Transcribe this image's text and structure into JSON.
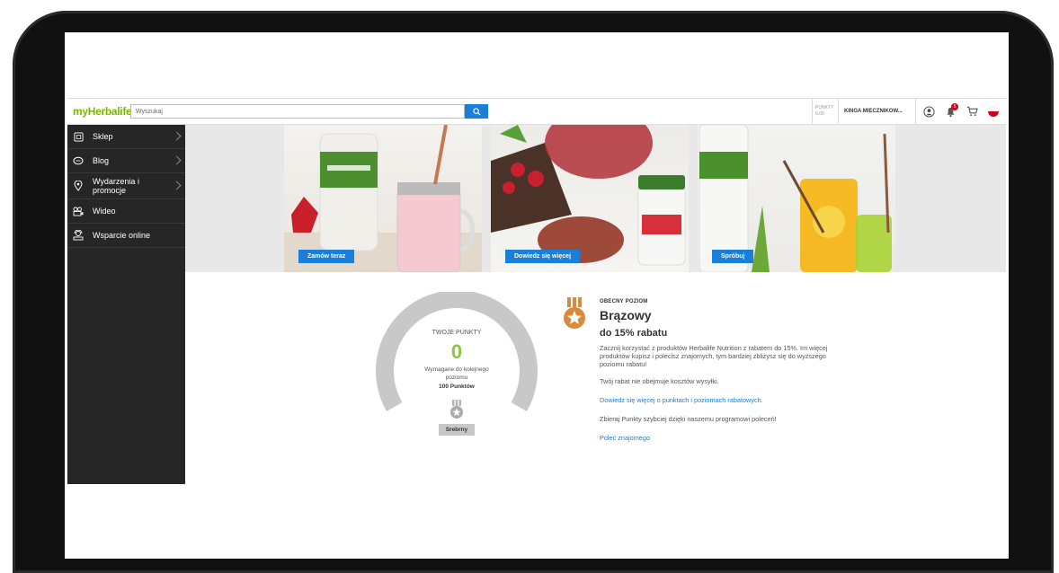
{
  "header": {
    "logo": "myHerbalife",
    "search_placeholder": "Wyszukaj",
    "points_label": "PUNKTY",
    "points_value": "0,00",
    "user_name": "KINGA MIECZNIKOW...",
    "notification_count": "5"
  },
  "sidebar": {
    "items": [
      {
        "label": "Sklep",
        "icon": "shop-icon"
      },
      {
        "label": "Blog",
        "icon": "chat-icon"
      },
      {
        "label": "Wydarzenia i promocje",
        "icon": "location-icon"
      },
      {
        "label": "Wideo",
        "icon": "video-icon"
      },
      {
        "label": "Wsparcie online",
        "icon": "support-icon"
      }
    ]
  },
  "banners": [
    {
      "cta": "Zamów teraz"
    },
    {
      "cta": "Dowiedz się więcej"
    },
    {
      "cta": "Spróbuj"
    }
  ],
  "gauge": {
    "title": "TWOJE PUNKTY",
    "value": "0",
    "required_line1": "Wymagane do kolejnego",
    "required_line2": "poziomu",
    "required_points": "100 Punktów",
    "next_level": "Srebrny",
    "progress": 0
  },
  "level": {
    "label": "OBECNY POZIOM",
    "name": "Brązowy",
    "discount": "do 15% rabatu",
    "description": "Zacznij korzystać z produktów Herbalife Nutrition z rabatem do 15%. Im więcej produktów kupisz i polecisz znajomych, tym bardziej zbliżysz się do wyższego poziomu rabatu!",
    "shipping_note": "Twój rabat nie obejmuje kosztów wysyłki.",
    "learn_link": "Dowiedz się więcej o punktach i poziomach rabatowych.",
    "referral_text": "Zbieraj Punkty szybciej dzięki naszemu programowi poleceń!",
    "refer_link": "Poleć znajomego"
  },
  "colors": {
    "brand_green": "#7ab800",
    "accent_blue": "#1a7fd9",
    "bronze": "#d98a3a",
    "sidebar_bg": "#262626"
  }
}
